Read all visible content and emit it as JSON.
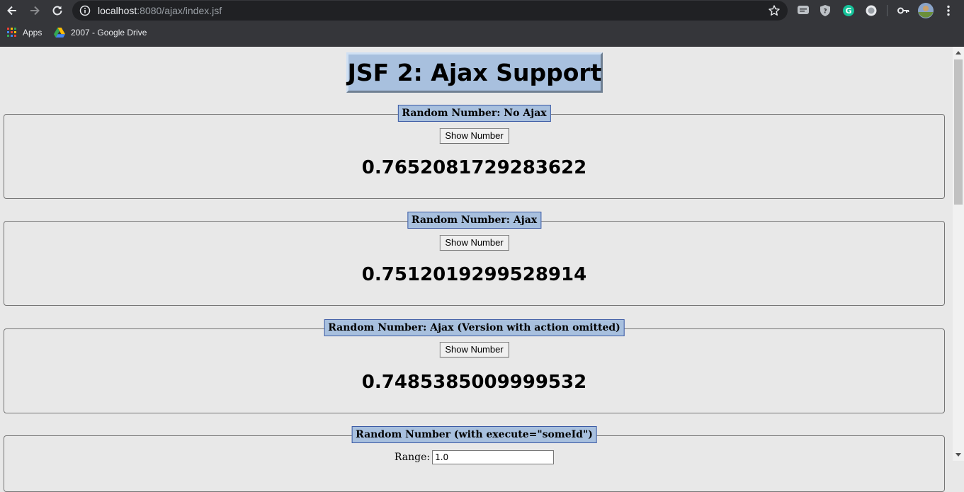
{
  "browser": {
    "url_host": "localhost",
    "url_rest": ":8080/ajax/index.jsf",
    "bookmarks": [
      {
        "label": "Apps",
        "icon": "apps-grid-icon"
      },
      {
        "label": "2007 - Google Drive",
        "icon": "google-drive-icon"
      }
    ],
    "extensions": [
      "chat-extension-icon",
      "shield-extension-icon",
      "grammarly-icon",
      "record-extension-icon",
      "key-icon",
      "profile-avatar",
      "menu-dots-icon"
    ]
  },
  "page": {
    "title": "JSF 2: Ajax Support",
    "sections": [
      {
        "legend": "Random Number: No Ajax",
        "button": "Show Number",
        "value": "0.7652081729283622"
      },
      {
        "legend": "Random Number: Ajax",
        "button": "Show Number",
        "value": "0.7512019299528914"
      },
      {
        "legend": "Random Number: Ajax (Version with action omitted)",
        "button": "Show Number",
        "value": "0.7485385009999532"
      },
      {
        "legend": "Random Number (with execute=\"someId\")",
        "range_label": "Range:",
        "range_value": "1.0"
      }
    ]
  },
  "colors": {
    "chrome_bg": "#35363a",
    "omnibox_bg": "#202124",
    "page_bg": "#e8e8e8",
    "legend_bg": "#a8c0de",
    "legend_border": "#3b5aa5"
  }
}
